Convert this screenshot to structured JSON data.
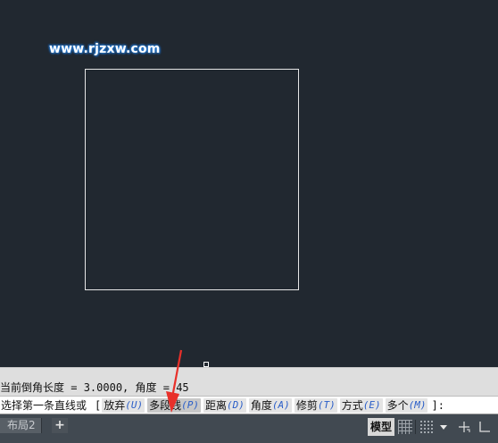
{
  "watermark": "www.rjzxw.com",
  "history": {
    "label": "当前倒角长度",
    "eq1": " = 3.0000, ",
    "label2": "角度",
    "eq2": " = 45"
  },
  "command": {
    "prompt": "选择第一条直线或",
    "open_bracket": "[",
    "close_bracket": "]:",
    "options": [
      {
        "label": "放弃",
        "key": "(U)"
      },
      {
        "label": "多段线",
        "key": "(P)"
      },
      {
        "label": "距离",
        "key": "(D)"
      },
      {
        "label": "角度",
        "key": "(A)"
      },
      {
        "label": "修剪",
        "key": "(T)"
      },
      {
        "label": "方式",
        "key": "(E)"
      },
      {
        "label": "多个",
        "key": "(M)"
      }
    ]
  },
  "status": {
    "layout_tab": "布局2",
    "add_tab": "+",
    "model_button": "模型"
  },
  "colors": {
    "canvas": "#212830",
    "annotation_arrow": "#e8302a",
    "option_key": "#2a5ec8"
  },
  "icons": [
    "grid-icon",
    "snap-icon",
    "dropdown-icon",
    "crosshair-icon",
    "ortho-icon"
  ]
}
